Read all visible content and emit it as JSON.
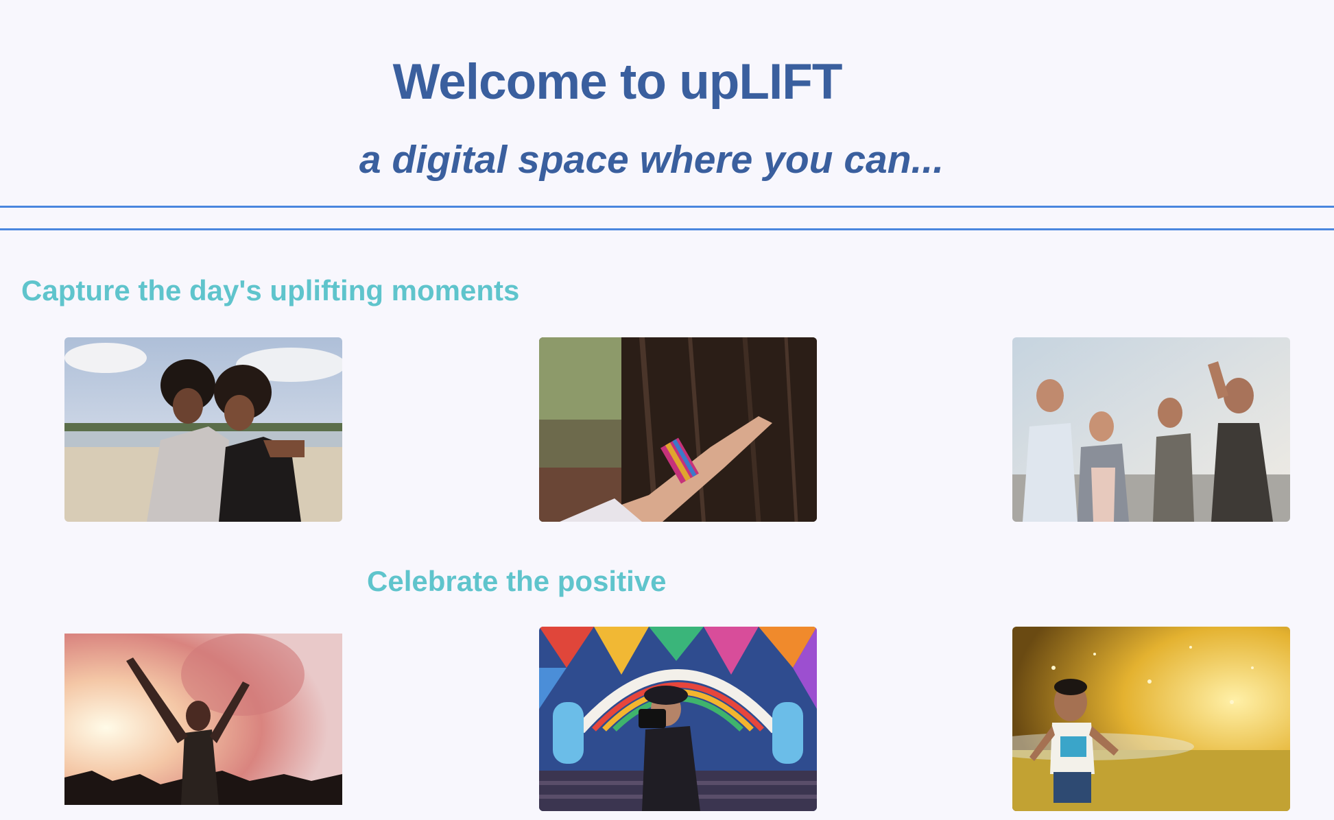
{
  "header": {
    "title": "Welcome to upLIFT",
    "subtitle": "a digital space where you can..."
  },
  "sections": [
    {
      "heading": "Capture the day's uplifting moments"
    },
    {
      "heading": "Celebrate the positive"
    }
  ],
  "colors": {
    "background": "#f8f7fd",
    "title": "#3a5f9e",
    "rule": "#4a86de",
    "section_heading": "#5fc4cc"
  }
}
